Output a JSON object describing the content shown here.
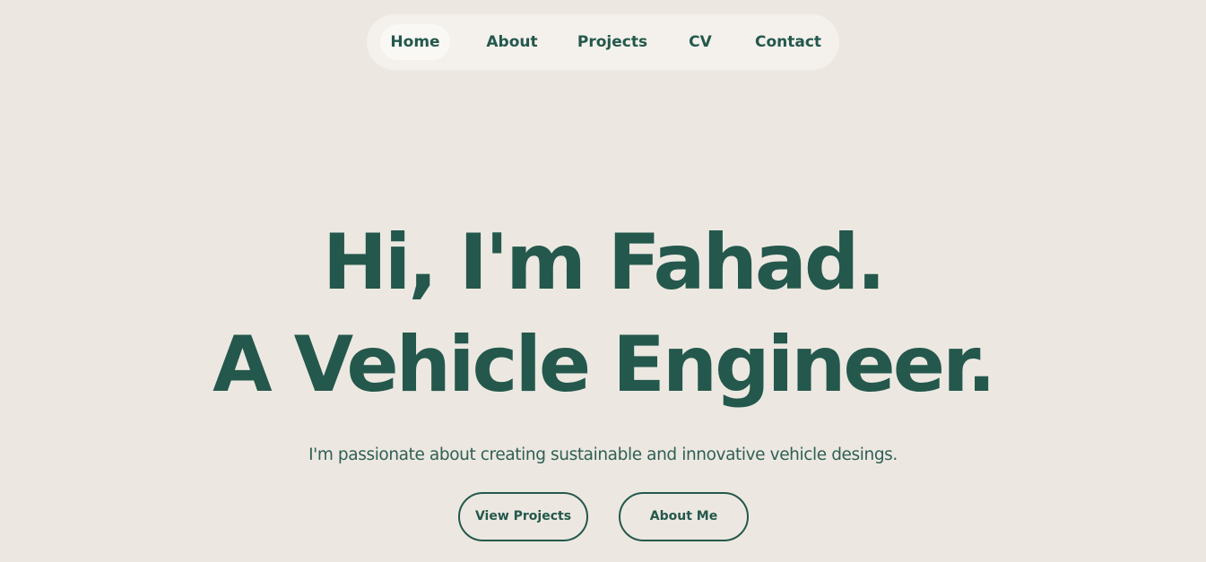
{
  "nav": {
    "items": [
      {
        "label": "Home",
        "active": true
      },
      {
        "label": "About",
        "active": false
      },
      {
        "label": "Projects",
        "active": false
      },
      {
        "label": "CV",
        "active": false
      },
      {
        "label": "Contact",
        "active": false
      }
    ]
  },
  "hero": {
    "line1": "Hi, I'm Fahad.",
    "line2": "A Vehicle Engineer."
  },
  "subtitle": "I'm passionate about creating sustainable and innovative vehicle desings.",
  "buttons": {
    "view_projects": "View Projects",
    "about_me": "About Me"
  },
  "colors": {
    "background": "#ece8e1",
    "nav_background": "#f4f1ec",
    "accent": "#24584c"
  }
}
